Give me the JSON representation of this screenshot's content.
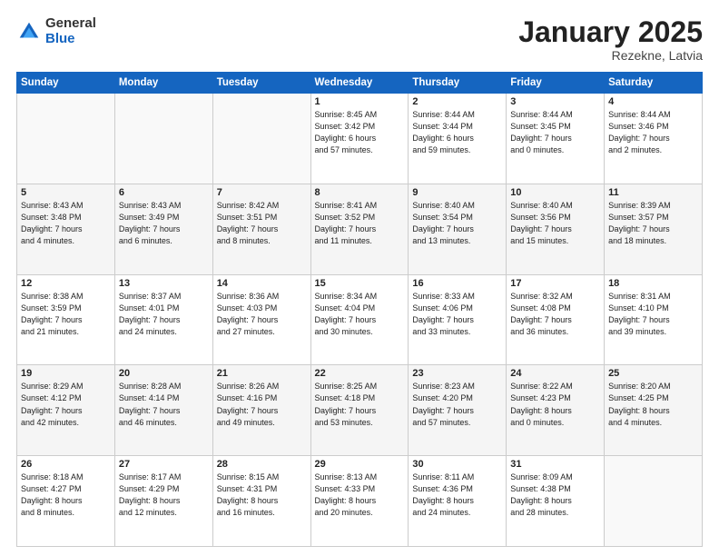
{
  "header": {
    "logo_general": "General",
    "logo_blue": "Blue",
    "title": "January 2025",
    "location": "Rezekne, Latvia"
  },
  "days_of_week": [
    "Sunday",
    "Monday",
    "Tuesday",
    "Wednesday",
    "Thursday",
    "Friday",
    "Saturday"
  ],
  "weeks": [
    [
      {
        "num": "",
        "info": ""
      },
      {
        "num": "",
        "info": ""
      },
      {
        "num": "",
        "info": ""
      },
      {
        "num": "1",
        "info": "Sunrise: 8:45 AM\nSunset: 3:42 PM\nDaylight: 6 hours\nand 57 minutes."
      },
      {
        "num": "2",
        "info": "Sunrise: 8:44 AM\nSunset: 3:44 PM\nDaylight: 6 hours\nand 59 minutes."
      },
      {
        "num": "3",
        "info": "Sunrise: 8:44 AM\nSunset: 3:45 PM\nDaylight: 7 hours\nand 0 minutes."
      },
      {
        "num": "4",
        "info": "Sunrise: 8:44 AM\nSunset: 3:46 PM\nDaylight: 7 hours\nand 2 minutes."
      }
    ],
    [
      {
        "num": "5",
        "info": "Sunrise: 8:43 AM\nSunset: 3:48 PM\nDaylight: 7 hours\nand 4 minutes."
      },
      {
        "num": "6",
        "info": "Sunrise: 8:43 AM\nSunset: 3:49 PM\nDaylight: 7 hours\nand 6 minutes."
      },
      {
        "num": "7",
        "info": "Sunrise: 8:42 AM\nSunset: 3:51 PM\nDaylight: 7 hours\nand 8 minutes."
      },
      {
        "num": "8",
        "info": "Sunrise: 8:41 AM\nSunset: 3:52 PM\nDaylight: 7 hours\nand 11 minutes."
      },
      {
        "num": "9",
        "info": "Sunrise: 8:40 AM\nSunset: 3:54 PM\nDaylight: 7 hours\nand 13 minutes."
      },
      {
        "num": "10",
        "info": "Sunrise: 8:40 AM\nSunset: 3:56 PM\nDaylight: 7 hours\nand 15 minutes."
      },
      {
        "num": "11",
        "info": "Sunrise: 8:39 AM\nSunset: 3:57 PM\nDaylight: 7 hours\nand 18 minutes."
      }
    ],
    [
      {
        "num": "12",
        "info": "Sunrise: 8:38 AM\nSunset: 3:59 PM\nDaylight: 7 hours\nand 21 minutes."
      },
      {
        "num": "13",
        "info": "Sunrise: 8:37 AM\nSunset: 4:01 PM\nDaylight: 7 hours\nand 24 minutes."
      },
      {
        "num": "14",
        "info": "Sunrise: 8:36 AM\nSunset: 4:03 PM\nDaylight: 7 hours\nand 27 minutes."
      },
      {
        "num": "15",
        "info": "Sunrise: 8:34 AM\nSunset: 4:04 PM\nDaylight: 7 hours\nand 30 minutes."
      },
      {
        "num": "16",
        "info": "Sunrise: 8:33 AM\nSunset: 4:06 PM\nDaylight: 7 hours\nand 33 minutes."
      },
      {
        "num": "17",
        "info": "Sunrise: 8:32 AM\nSunset: 4:08 PM\nDaylight: 7 hours\nand 36 minutes."
      },
      {
        "num": "18",
        "info": "Sunrise: 8:31 AM\nSunset: 4:10 PM\nDaylight: 7 hours\nand 39 minutes."
      }
    ],
    [
      {
        "num": "19",
        "info": "Sunrise: 8:29 AM\nSunset: 4:12 PM\nDaylight: 7 hours\nand 42 minutes."
      },
      {
        "num": "20",
        "info": "Sunrise: 8:28 AM\nSunset: 4:14 PM\nDaylight: 7 hours\nand 46 minutes."
      },
      {
        "num": "21",
        "info": "Sunrise: 8:26 AM\nSunset: 4:16 PM\nDaylight: 7 hours\nand 49 minutes."
      },
      {
        "num": "22",
        "info": "Sunrise: 8:25 AM\nSunset: 4:18 PM\nDaylight: 7 hours\nand 53 minutes."
      },
      {
        "num": "23",
        "info": "Sunrise: 8:23 AM\nSunset: 4:20 PM\nDaylight: 7 hours\nand 57 minutes."
      },
      {
        "num": "24",
        "info": "Sunrise: 8:22 AM\nSunset: 4:23 PM\nDaylight: 8 hours\nand 0 minutes."
      },
      {
        "num": "25",
        "info": "Sunrise: 8:20 AM\nSunset: 4:25 PM\nDaylight: 8 hours\nand 4 minutes."
      }
    ],
    [
      {
        "num": "26",
        "info": "Sunrise: 8:18 AM\nSunset: 4:27 PM\nDaylight: 8 hours\nand 8 minutes."
      },
      {
        "num": "27",
        "info": "Sunrise: 8:17 AM\nSunset: 4:29 PM\nDaylight: 8 hours\nand 12 minutes."
      },
      {
        "num": "28",
        "info": "Sunrise: 8:15 AM\nSunset: 4:31 PM\nDaylight: 8 hours\nand 16 minutes."
      },
      {
        "num": "29",
        "info": "Sunrise: 8:13 AM\nSunset: 4:33 PM\nDaylight: 8 hours\nand 20 minutes."
      },
      {
        "num": "30",
        "info": "Sunrise: 8:11 AM\nSunset: 4:36 PM\nDaylight: 8 hours\nand 24 minutes."
      },
      {
        "num": "31",
        "info": "Sunrise: 8:09 AM\nSunset: 4:38 PM\nDaylight: 8 hours\nand 28 minutes."
      },
      {
        "num": "",
        "info": ""
      }
    ]
  ]
}
